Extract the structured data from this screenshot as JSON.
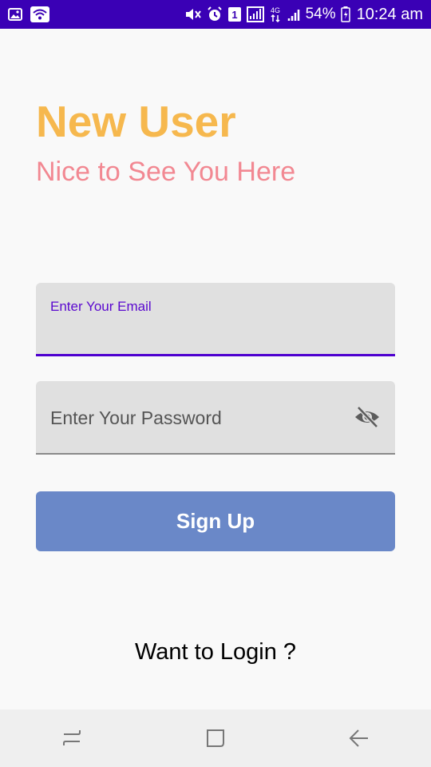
{
  "status_bar": {
    "battery_percent": "54%",
    "time": "10:24 am",
    "network_label": "4G",
    "sim_label": "1",
    "icons": [
      "image-icon",
      "wifi-icon",
      "mute-icon",
      "alarm-icon",
      "sim-icon",
      "signal-icon",
      "data-icon",
      "signal-icon-2",
      "battery-icon"
    ]
  },
  "header": {
    "title": "New User",
    "subtitle": "Nice to See You Here"
  },
  "form": {
    "email_label": "Enter Your Email",
    "email_value": "",
    "password_placeholder": "Enter Your Password",
    "signup_label": "Sign Up"
  },
  "footer": {
    "login_link": "Want to Login ?"
  },
  "nav": {
    "icons": [
      "recents-icon",
      "home-icon",
      "back-icon"
    ]
  },
  "colors": {
    "status_bar": "#3a00b5",
    "title": "#f6b84e",
    "subtitle": "#f28892",
    "accent": "#4e00cf",
    "button": "#6a88c8"
  }
}
